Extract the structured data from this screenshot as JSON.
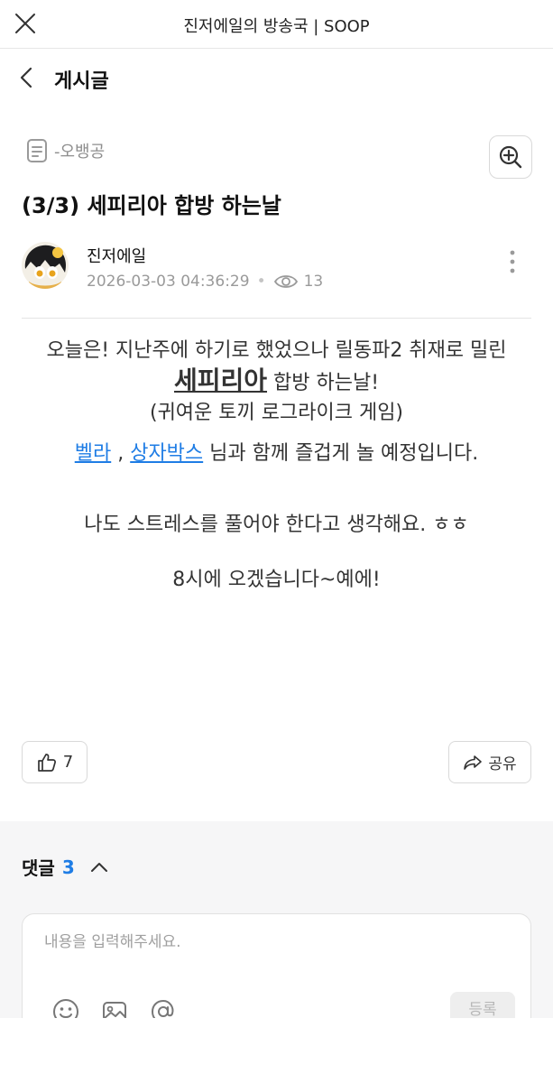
{
  "topbar": {
    "title": "진저에일의 방송국 | SOOP"
  },
  "header": {
    "title": "게시글"
  },
  "post": {
    "category": "-오뱅공",
    "title": "(3/3) 세피리아 합방 하는날",
    "author": "진저에일",
    "datetime": "2026-03-03 04:36:29",
    "dot": "•",
    "views": "13"
  },
  "content": {
    "line1": "오늘은! 지난주에 하기로 했었으나 릴동파2 취재로 밀린",
    "game_link": "세피리아",
    "line2_suffix": " 합방 하는날!",
    "line3": "(귀여운 토끼 로그라이크 게임)",
    "link_bella": "벨라",
    "comma": " , ",
    "link_sangja": "상자박스",
    "line4_suffix": " 님과 함께 즐겁게 놀 예정입니다.",
    "line5": "나도 스트레스를 풀어야 한다고 생각해요. ㅎㅎ",
    "line6": "8시에 오겠습니다~예에!"
  },
  "actions": {
    "like_count": "7",
    "share_label": "공유"
  },
  "comments": {
    "label": "댓글",
    "count": "3",
    "placeholder": "내용을 입력해주세요.",
    "submit_label": "등록"
  },
  "colors": {
    "link": "#1f7de5",
    "comment_bg": "#f6f6f7",
    "border": "#d9d9d9"
  }
}
